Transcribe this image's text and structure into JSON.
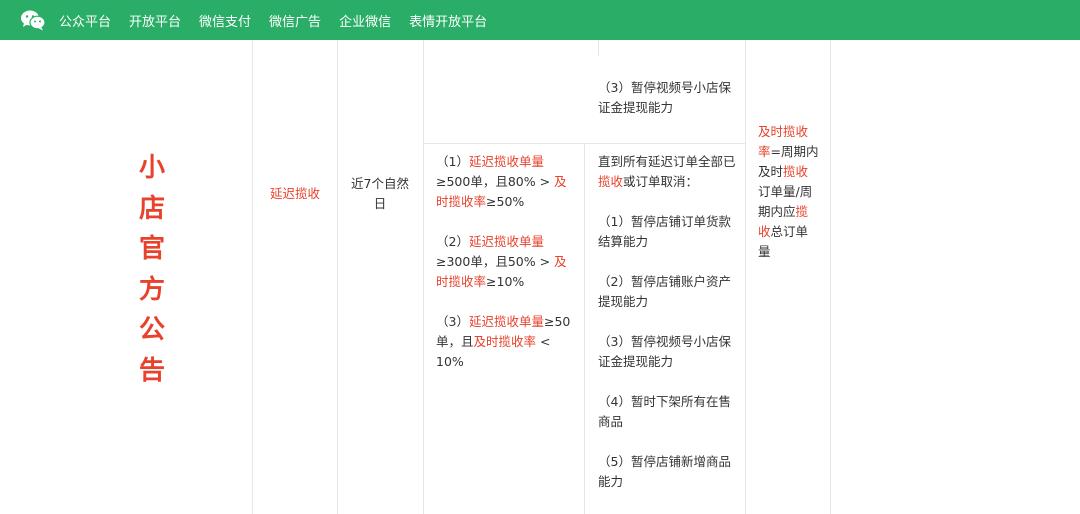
{
  "nav": {
    "items": [
      "公众平台",
      "开放平台",
      "微信支付",
      "微信广告",
      "企业微信",
      "表情开放平台"
    ]
  },
  "title_chars": [
    "小",
    "店",
    "官",
    "方",
    "公",
    "告"
  ],
  "row": {
    "indicator": "延迟揽收",
    "period": "近7个自然日",
    "top_prev_measure": "（3）暂停视频号小店保证金提现能力",
    "conditions": [
      {
        "pre": "（1）",
        "red1": "延迟揽收单量",
        "mid": "≥500单，且80% > ",
        "red2": "及时揽收率",
        "post": "≥50%"
      },
      {
        "pre": "（2）",
        "red1": "延迟揽收单量",
        "mid": "≥300单，且50% > ",
        "red2": "及时揽收率",
        "post": "≥10%"
      },
      {
        "pre": "（3）",
        "red1": "延迟揽收单量",
        "mid": "≥50单，且",
        "red2": "及时揽收率",
        "post": " < 10%"
      }
    ],
    "measures_intro": {
      "pre": "直到所有延迟订单全部已",
      "red": "揽收",
      "post": "或订单取消："
    },
    "measures": [
      "（1）暂停店铺订单货款结算能力",
      "（2）暂停店铺账户资产提现能力",
      "（3）暂停视频号小店保证金提现能力",
      "（4）暂时下架所有在售商品",
      "（5）暂停店铺新增商品能力"
    ],
    "definition": {
      "red1": "及时揽收率",
      "t1": "=周期内及时",
      "red2": "揽收",
      "t2": "订单量/周期内应",
      "red3": "揽收",
      "t3": "总订单量"
    }
  }
}
